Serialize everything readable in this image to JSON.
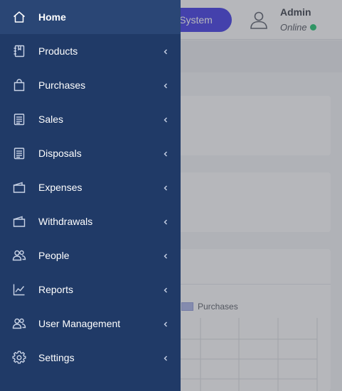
{
  "topbar": {
    "pos_button_label": "OS System",
    "user_name": "Admin",
    "status": "Online",
    "status_color": "#19c46b"
  },
  "chart_legend": {
    "label": "Purchases",
    "color": "#a9b3e8"
  },
  "sidebar": {
    "items": [
      {
        "label": "Home",
        "icon": "home-icon",
        "active": true,
        "has_submenu": false
      },
      {
        "label": "Products",
        "icon": "notebook-icon",
        "has_submenu": true
      },
      {
        "label": "Purchases",
        "icon": "shopping-bag-icon",
        "has_submenu": true
      },
      {
        "label": "Sales",
        "icon": "receipt-icon",
        "has_submenu": true
      },
      {
        "label": "Disposals",
        "icon": "receipt-icon",
        "has_submenu": true
      },
      {
        "label": "Expenses",
        "icon": "wallet-icon",
        "has_submenu": true
      },
      {
        "label": "Withdrawals",
        "icon": "wallet-icon",
        "has_submenu": true
      },
      {
        "label": "People",
        "icon": "users-icon",
        "has_submenu": true
      },
      {
        "label": "Reports",
        "icon": "chart-line-icon",
        "has_submenu": true
      },
      {
        "label": "User Management",
        "icon": "users-icon",
        "has_submenu": true
      },
      {
        "label": "Settings",
        "icon": "gear-icon",
        "has_submenu": true
      }
    ]
  },
  "colors": {
    "sidebar_bg": "#203a67",
    "sidebar_active_bg": "#2a4675",
    "accent": "#3b35e6"
  }
}
